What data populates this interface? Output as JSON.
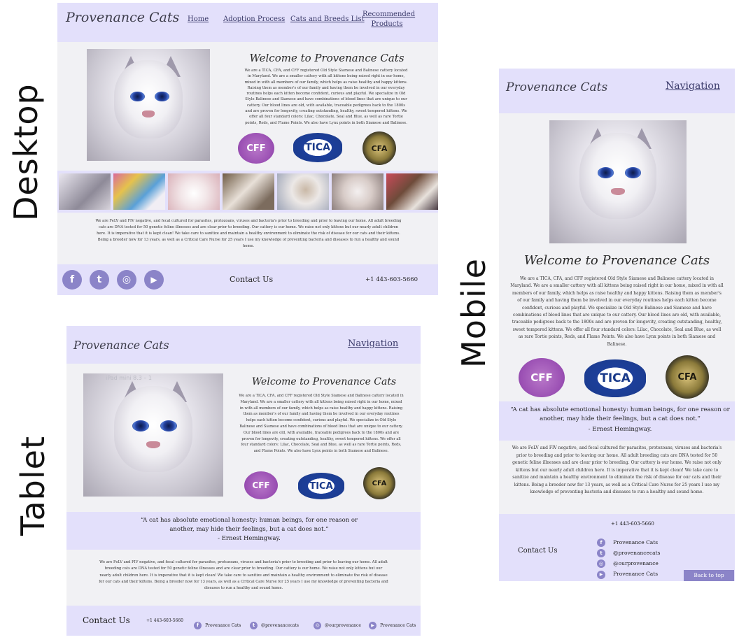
{
  "labels": {
    "desktop": "Desktop",
    "tablet": "Tablet",
    "mobile": "Mobile"
  },
  "site": {
    "logo": "Provenance Cats",
    "nav_toggle": "Navigation",
    "nav": [
      "Home",
      "Adoption Process",
      "Cats and Breeds List",
      "Recommended Products"
    ],
    "welcome": "Welcome to Provenance Cats",
    "intro": "We are a TICA, CFA, and CFF registered Old Style Siamese and Balinese cattery located in Maryland. We are a smaller cattery with all kittens being raised right in our home, mixed in with all members of our family, which helps as raise healthy and happy kittens. Raising them as member's of our family and having them be involved in our everyday routines helps each kitten become confident, curious and playful. We specialize in Old Style Balinese and Siamese and have combinations of blood lines that are unique to our cattery. Our blood lines are old, with available, traceable pedigrees back to the 1800s and are proven for longevity, creating outstanding, healthy, sweet tempered kittens. We offer all four standard colors: Lilac, Chocolate, Seal and Blue, as well as rare Tortie points, Reds, and Flame Points. We also have Lynx points in both Siamese and Balinese.",
    "health": "We are FeLV and FIV negative, and fecal cultured for parasites, protozoans, viruses and bacteria's prior to breeding and prior to leaving our home. All adult breeding cats are DNA tested for 50 genetic feline illnesses and are clear prior to breeding. Our cattery is our home. We raise not only kittens but our nearly adult children here. It is imperative that it is kept clean! We take care to sanitize and maintain a healthy environment to eliminate the risk of disease for our cats and their kittens. Being a breeder now for 13 years, as well as a Critical Care Nurse for 25 years I use my knowledge of preventing bacteria and diseases to run a healthy and sound home.",
    "quote_line1": "“A cat has absolute emotional honesty: human beings, for one reason or another, may hide their feelings, but a cat does not.”",
    "quote_author": "- Ernest Hemingway.",
    "badges": [
      "CFF",
      "TICA",
      "CFA"
    ],
    "contact_label": "Contact Us",
    "phone": "+1 443-603-5660",
    "social": {
      "facebook": "Provenance Cats",
      "twitter": "@provenancecats",
      "instagram": "@ourprovenance",
      "youtube": "Provenance Cats"
    },
    "back_to_top": "Back to top",
    "tablet_overlay": "iPad mini 8.3 – 1"
  },
  "icons": {
    "facebook": "f",
    "twitter": "t",
    "instagram": "◎",
    "youtube": "▶"
  },
  "colors": {
    "lavender": "#e3e0fb",
    "panel_gray": "#f1f1f4",
    "icon_purple": "#8b84c8",
    "back_to_top": "#8b84c8"
  }
}
